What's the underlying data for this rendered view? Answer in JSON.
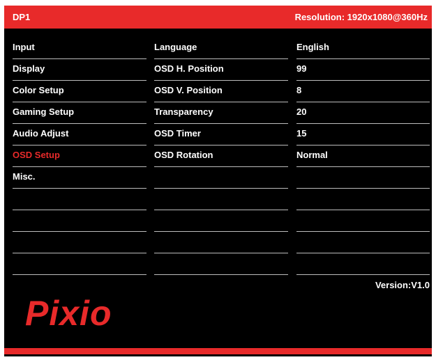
{
  "header": {
    "source": "DP1",
    "resolution": "Resolution: 1920x1080@360Hz"
  },
  "menu": {
    "items": [
      {
        "label": "Input"
      },
      {
        "label": "Display"
      },
      {
        "label": "Color Setup"
      },
      {
        "label": "Gaming Setup"
      },
      {
        "label": "Audio Adjust"
      },
      {
        "label": "OSD Setup",
        "selected": true
      },
      {
        "label": "Misc."
      }
    ]
  },
  "settings": {
    "items": [
      {
        "label": "Language",
        "value": "English"
      },
      {
        "label": "OSD H. Position",
        "value": "99"
      },
      {
        "label": "OSD V. Position",
        "value": "8"
      },
      {
        "label": "Transparency",
        "value": "20"
      },
      {
        "label": "OSD Timer",
        "value": "15"
      },
      {
        "label": "OSD Rotation",
        "value": "Normal"
      }
    ]
  },
  "version": "Version:V1.0",
  "logo": "Pixio",
  "colors": {
    "accent": "#e82a2a",
    "background": "#000000",
    "text": "#ffffff",
    "divider": "#bdbdbd"
  }
}
